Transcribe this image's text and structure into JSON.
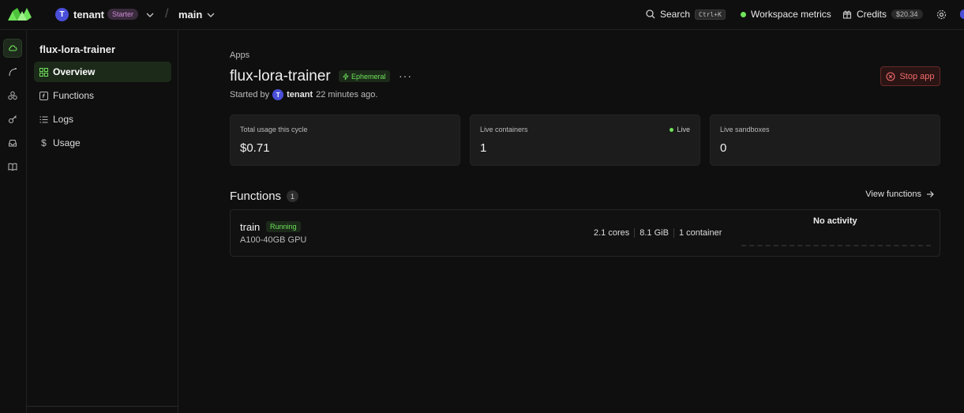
{
  "topbar": {
    "tenant_initial": "T",
    "tenant_name": "tenant",
    "plan": "Starter",
    "environment": "main",
    "search_label": "Search",
    "search_shortcut": "Ctrl+K",
    "metrics_label": "Workspace metrics",
    "credits_label": "Credits",
    "credits_value": "$20.34"
  },
  "rail": {
    "items": [
      "apps-icon",
      "deploy-icon",
      "dashboard-icon",
      "secrets-icon",
      "storage-icon",
      "docs-icon"
    ]
  },
  "sidebar": {
    "title": "flux-lora-trainer",
    "items": [
      {
        "label": "Overview",
        "icon": "grid-icon"
      },
      {
        "label": "Functions",
        "icon": "function-icon"
      },
      {
        "label": "Logs",
        "icon": "list-icon"
      },
      {
        "label": "Usage",
        "icon": "dollar-icon"
      }
    ]
  },
  "main": {
    "breadcrumb": "Apps",
    "app_title": "flux-lora-trainer",
    "ephemeral_badge": "Ephemeral",
    "more": "···",
    "started_by_prefix": "Started by",
    "started_by_initial": "T",
    "started_by_user": "tenant",
    "started_ago": "22 minutes ago.",
    "stop_button": "Stop app",
    "stats": [
      {
        "label": "Total usage this cycle",
        "value": "$0.71"
      },
      {
        "label": "Live containers",
        "value": "1",
        "live": "Live"
      },
      {
        "label": "Live sandboxes",
        "value": "0"
      }
    ],
    "functions_title": "Functions",
    "functions_count": "1",
    "view_functions": "View functions",
    "function": {
      "name": "train",
      "status": "Running",
      "gpu": "A100-40GB GPU",
      "cores": "2.1 cores",
      "memory": "8.1 GiB",
      "containers": "1 container",
      "activity": "No activity"
    }
  },
  "colors": {
    "accent_green": "#6fe35a",
    "danger": "#f26b6b",
    "avatar": "#4a4fd8",
    "plan_badge": "#d08bd6"
  }
}
